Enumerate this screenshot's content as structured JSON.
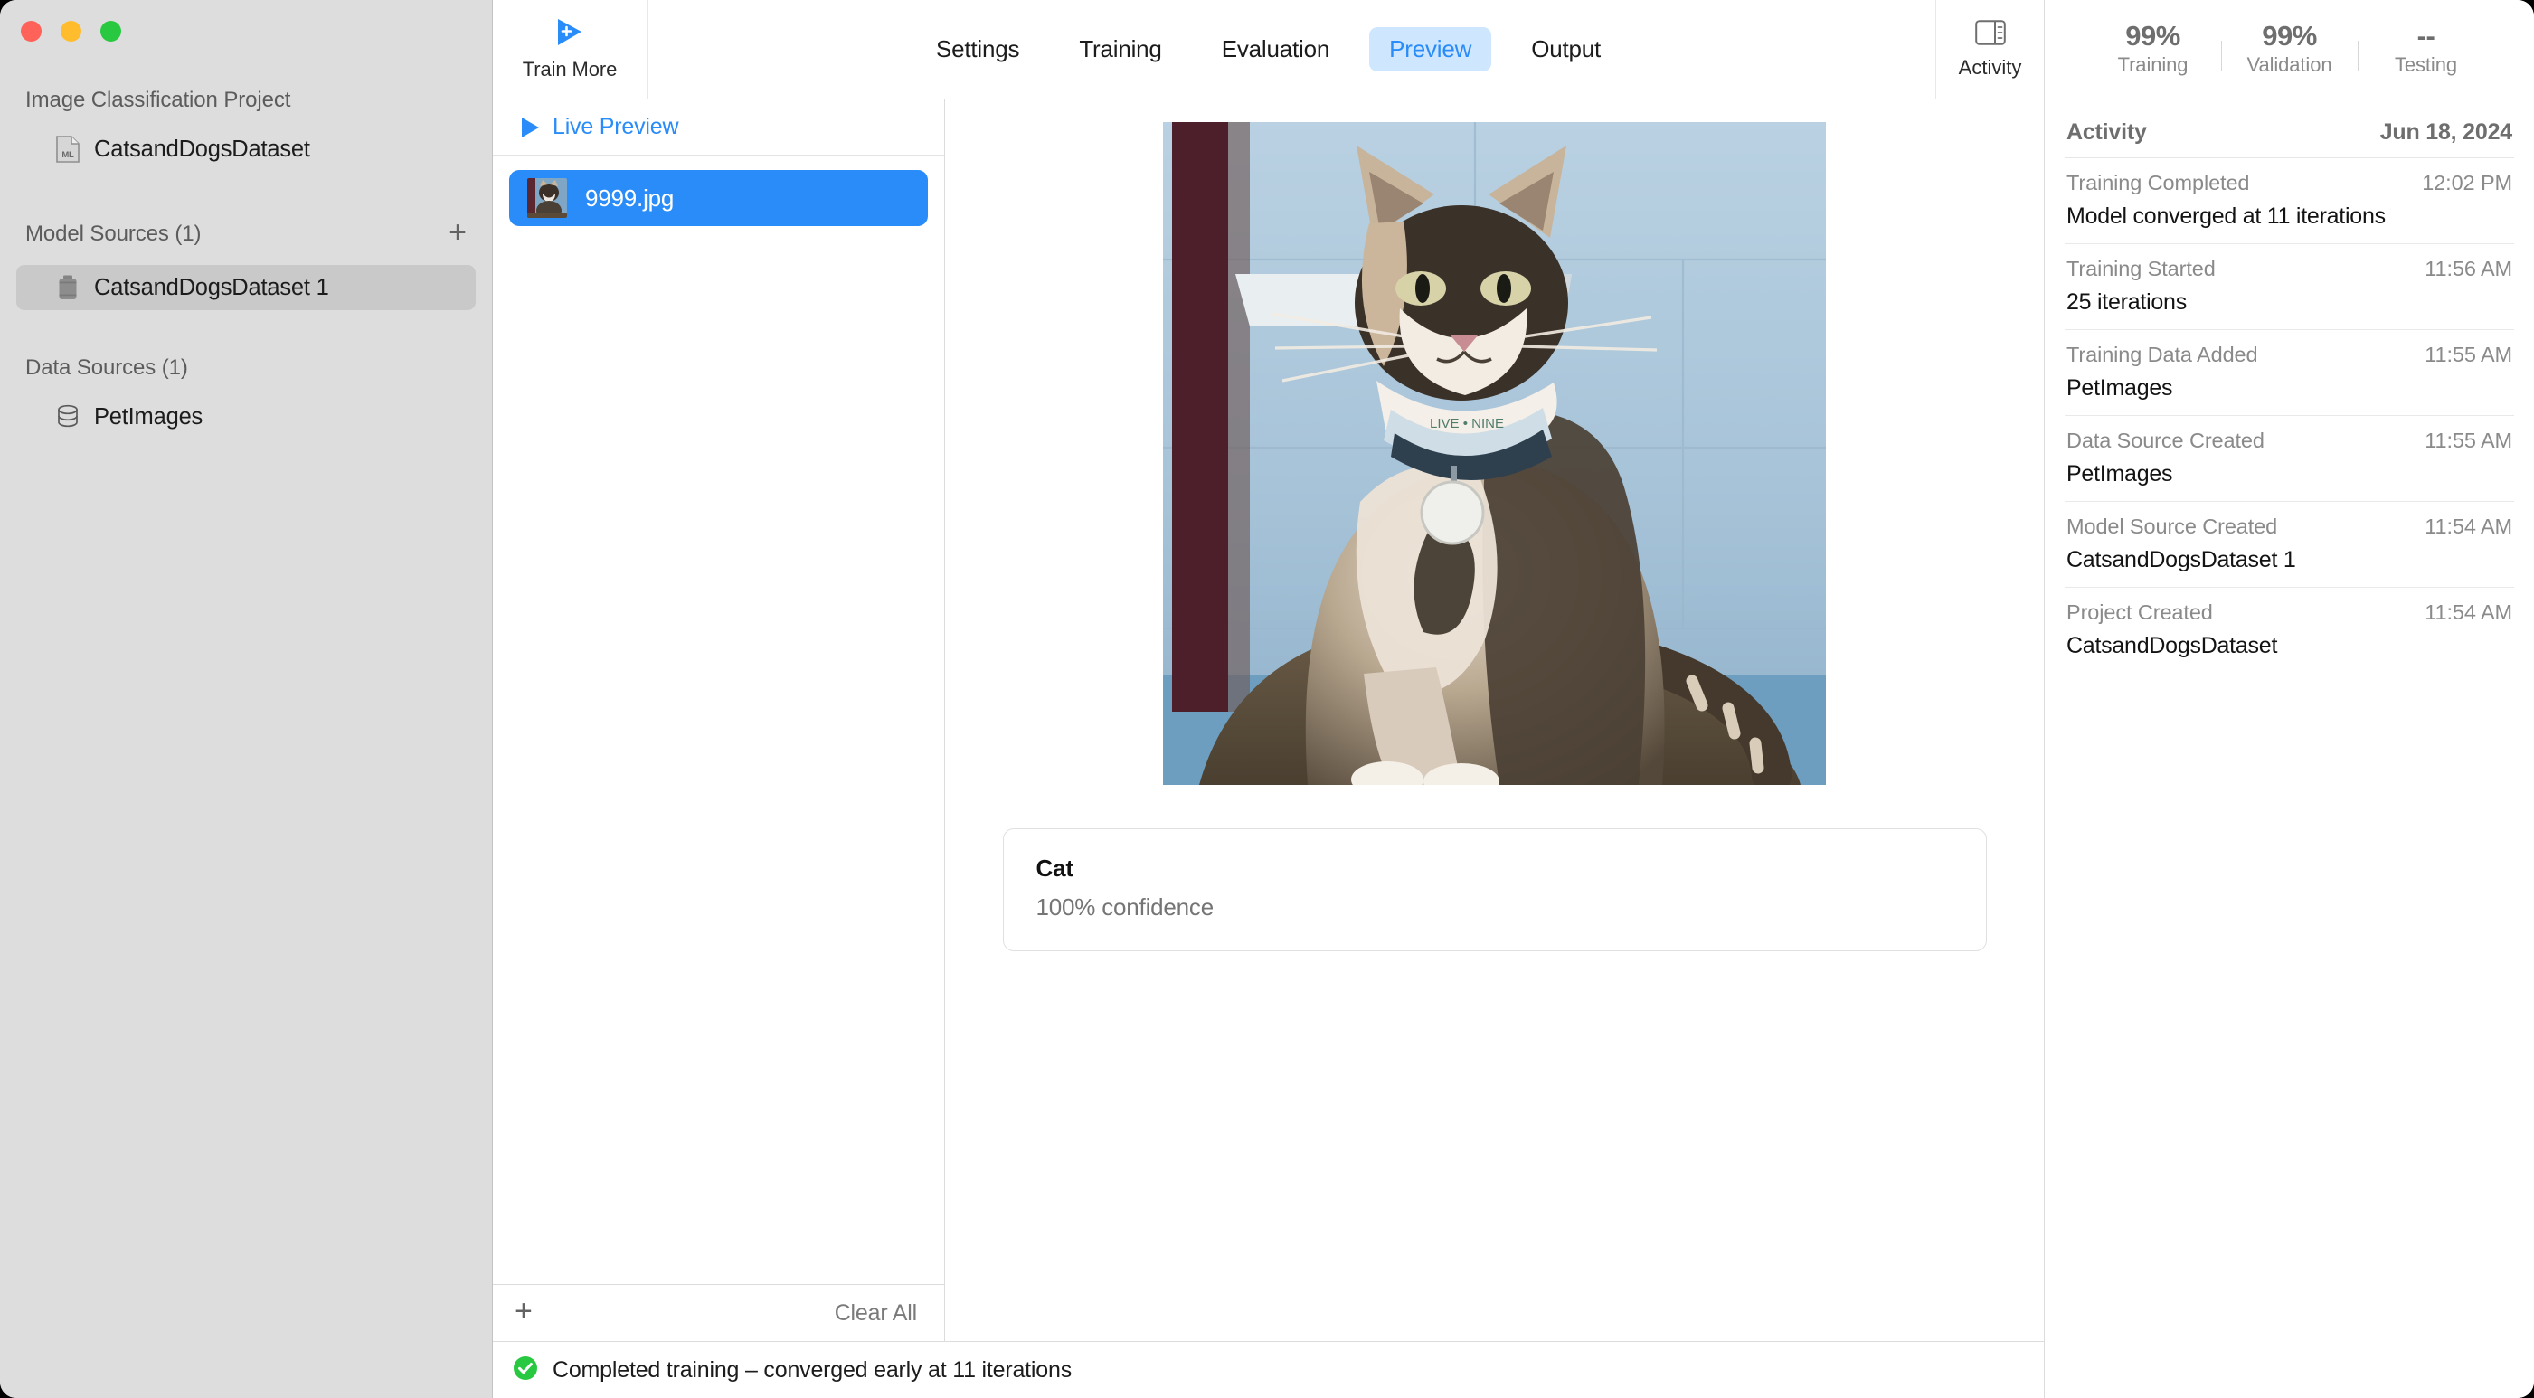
{
  "window": {
    "traffic_lights": [
      "close",
      "minimize",
      "maximize"
    ]
  },
  "sidebar": {
    "project_section_title": "Image Classification Project",
    "project_name": "CatsandDogsDataset",
    "model_sources_title": "Model Sources (1)",
    "model_sources_add_label": "+",
    "model_sources": [
      {
        "label": "CatsandDogsDataset 1",
        "selected": true
      }
    ],
    "data_sources_title": "Data Sources (1)",
    "data_sources": [
      {
        "label": "PetImages",
        "selected": false
      }
    ]
  },
  "toolbar": {
    "train_more_label": "Train More",
    "activity_label": "Activity",
    "tabs": [
      {
        "label": "Settings",
        "active": false
      },
      {
        "label": "Training",
        "active": false
      },
      {
        "label": "Evaluation",
        "active": false
      },
      {
        "label": "Preview",
        "active": true
      },
      {
        "label": "Output",
        "active": false
      }
    ]
  },
  "file_list": {
    "live_preview_label": "Live Preview",
    "items": [
      {
        "name": "9999.jpg",
        "selected": true
      }
    ],
    "add_label": "+",
    "clear_all_label": "Clear All"
  },
  "preview": {
    "image_alt": "cat-photo",
    "prediction_label": "Cat",
    "prediction_confidence": "100% confidence"
  },
  "status_bar": {
    "icon": "check-circle-icon",
    "message": "Completed training – converged early at 11 iterations"
  },
  "metrics": [
    {
      "value": "99%",
      "name": "Training"
    },
    {
      "value": "99%",
      "name": "Validation"
    },
    {
      "value": "--",
      "name": "Testing"
    }
  ],
  "activity": {
    "title": "Activity",
    "date": "Jun 18, 2024",
    "entries": [
      {
        "type": "Training Completed",
        "time": "12:02 PM",
        "detail": "Model converged at 11 iterations"
      },
      {
        "type": "Training Started",
        "time": "11:56 AM",
        "detail": "25 iterations"
      },
      {
        "type": "Training Data Added",
        "time": "11:55 AM",
        "detail": "PetImages"
      },
      {
        "type": "Data Source Created",
        "time": "11:55 AM",
        "detail": "PetImages"
      },
      {
        "type": "Model Source Created",
        "time": "11:54 AM",
        "detail": "CatsandDogsDataset 1"
      },
      {
        "type": "Project Created",
        "time": "11:54 AM",
        "detail": "CatsandDogsDataset"
      }
    ]
  },
  "colors": {
    "accent_blue": "#2a8cf8",
    "tab_active_bg": "#cfe6ff",
    "sidebar_bg": "#dddddd",
    "selected_row_bg": "#c9c9c9",
    "success_green": "#28c840"
  }
}
